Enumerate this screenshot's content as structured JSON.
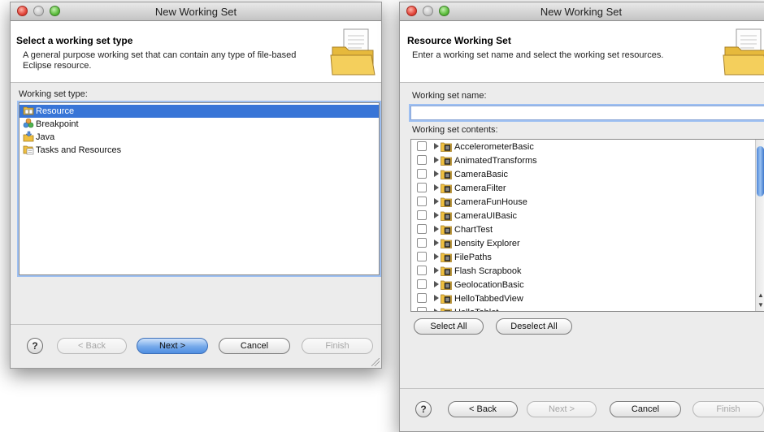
{
  "left_dialog": {
    "window_title": "New Working Set",
    "header_title": "Select a working set type",
    "header_description": "A general purpose working set that can contain any type of file-based Eclipse resource.",
    "list_label": "Working set type:",
    "types": [
      {
        "label": "Resource",
        "icon": "resource-icon",
        "selected": true
      },
      {
        "label": "Breakpoint",
        "icon": "breakpoint-icon",
        "selected": false
      },
      {
        "label": "Java",
        "icon": "java-icon",
        "selected": false
      },
      {
        "label": "Tasks and Resources",
        "icon": "tasks-icon",
        "selected": false
      }
    ],
    "buttons": {
      "help": "?",
      "back": "< Back",
      "next": "Next >",
      "cancel": "Cancel",
      "finish": "Finish"
    }
  },
  "right_dialog": {
    "window_title": "New Working Set",
    "header_title": "Resource Working Set",
    "header_description": "Enter a working set name and select the working set resources.",
    "name_label": "Working set name:",
    "name_value": "",
    "contents_label": "Working set contents:",
    "projects": [
      "AccelerometerBasic",
      "AnimatedTransforms",
      "CameraBasic",
      "CameraFilter",
      "CameraFunHouse",
      "CameraUIBasic",
      "ChartTest",
      "Density Explorer",
      "FilePaths",
      "Flash Scrapbook",
      "GeolocationBasic",
      "HelloTabbedView",
      "HelloTablet"
    ],
    "select_all": "Select All",
    "deselect_all": "Deselect All",
    "buttons": {
      "help": "?",
      "back": "< Back",
      "next": "Next >",
      "cancel": "Cancel",
      "finish": "Finish"
    }
  },
  "colors": {
    "selection": "#3875d7",
    "default_button": "#75a9ea"
  }
}
